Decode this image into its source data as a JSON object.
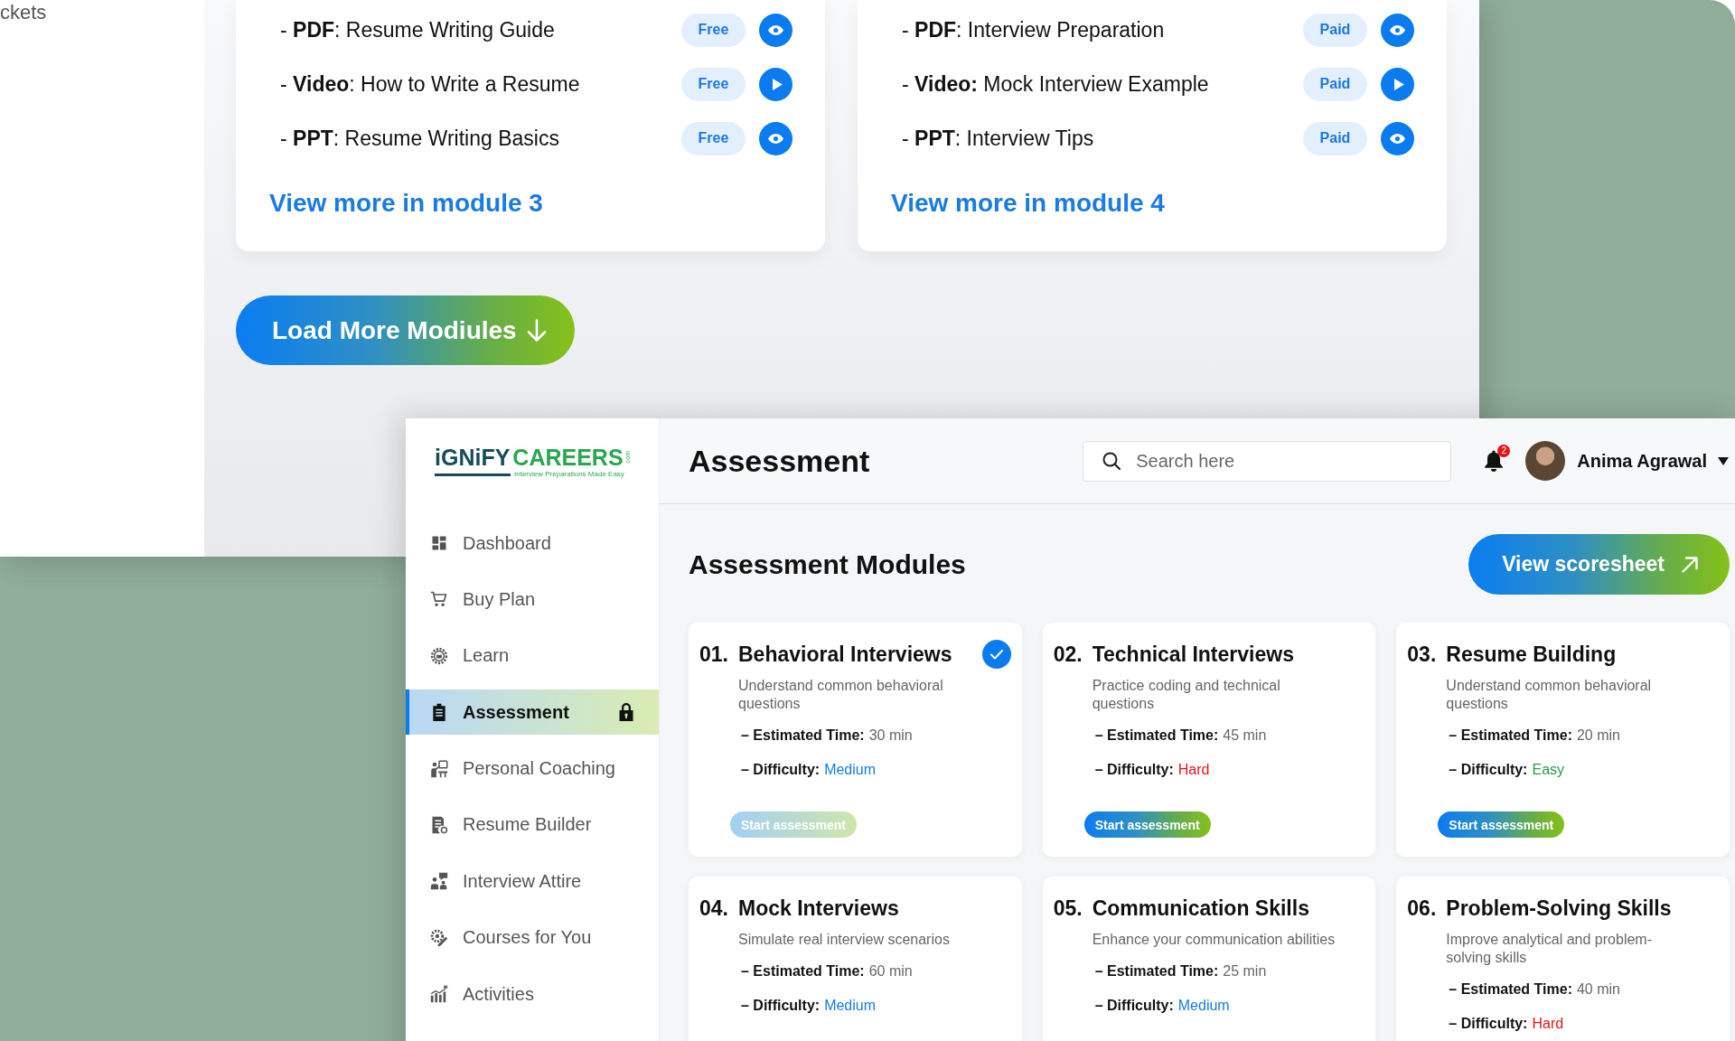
{
  "back_window": {
    "sidebar_fragment": "ckets",
    "resource_cards": [
      {
        "resources": [
          {
            "text": "- **PDF**: Resume Writing Guide",
            "access": "Free",
            "kind": "view"
          },
          {
            "text": "- **Video**: How to Write a Resume",
            "access": "Free",
            "kind": "play"
          },
          {
            "text": "- **PPT**: Resume Writing Basics",
            "access": "Free",
            "kind": "view"
          }
        ],
        "link": "View more in module 3"
      },
      {
        "resources": [
          {
            "text": "- **PDF**: Interview Preparation",
            "access": "Paid",
            "kind": "view"
          },
          {
            "text": "- **Video:** Mock Interview Example",
            "access": "Paid",
            "kind": "play"
          },
          {
            "text": "- **PPT**: Interview Tips",
            "access": "Paid",
            "kind": "view"
          }
        ],
        "link": "View more in module 4"
      }
    ],
    "load_more_button": "Load More Modiules"
  },
  "app": {
    "logo": {
      "brand": "iGNiFY",
      "brand_accent": "CAREERS",
      "domain": ".com",
      "tagline": "Interview Preparations Made Easy"
    },
    "sidebar": {
      "items": [
        {
          "label": "Dashboard",
          "selected": false,
          "locked": false
        },
        {
          "label": "Buy Plan",
          "selected": false,
          "locked": false
        },
        {
          "label": "Learn",
          "selected": false,
          "locked": false
        },
        {
          "label": "Assessment",
          "selected": true,
          "locked": true
        },
        {
          "label": "Personal Coaching",
          "selected": false,
          "locked": false
        },
        {
          "label": "Resume Builder",
          "selected": false,
          "locked": false
        },
        {
          "label": "Interview Attire",
          "selected": false,
          "locked": false
        },
        {
          "label": "Courses for You",
          "selected": false,
          "locked": false
        },
        {
          "label": "Activities",
          "selected": false,
          "locked": false
        }
      ]
    },
    "header": {
      "title": "Assessment",
      "search": {
        "placeholder": "Search here"
      },
      "notification_count": "2",
      "user": {
        "name": "Anima Agrawal"
      }
    },
    "section_title": "Assessment Modules",
    "scoresheet_button": "View scoresheet",
    "modules": [
      {
        "number": "01.",
        "title": "Behavioral Interviews",
        "description": "Understand common behavioral questions",
        "time_label": "– Estimated Time:",
        "time": "30 min",
        "difficulty_label": "– Difficulty:",
        "difficulty": {
          "value": "Medium",
          "color": "#1a7ae8"
        },
        "completed": true,
        "button": {
          "label": "Start assessment",
          "disabled": true
        }
      },
      {
        "number": "02.",
        "title": "Technical Interviews",
        "description": "Practice coding and technical questions",
        "time_label": "– Estimated Time:",
        "time": "45 min",
        "difficulty_label": "– Difficulty:",
        "difficulty": {
          "value": "Hard",
          "color": "#e3141b"
        },
        "completed": false,
        "button": {
          "label": "Start assessment",
          "disabled": false
        }
      },
      {
        "number": "03.",
        "title": "Resume Building",
        "description": "Understand common behavioral questions",
        "time_label": "– Estimated Time:",
        "time": "20 min",
        "difficulty_label": "– Difficulty:",
        "difficulty": {
          "value": "Easy",
          "color": "#2a9a4c"
        },
        "completed": false,
        "button": {
          "label": "Start assessment",
          "disabled": false
        }
      },
      {
        "number": "04.",
        "title": "Mock Interviews",
        "description": "Simulate real interview scenarios",
        "time_label": "– Estimated Time:",
        "time": "60 min",
        "difficulty_label": "– Difficulty:",
        "difficulty": {
          "value": "Medium",
          "color": "#1a7ae8"
        },
        "completed": false
      },
      {
        "number": "05.",
        "title": "Communication Skills",
        "description": "Enhance your communication abilities",
        "time_label": "– Estimated Time:",
        "time": "25 min",
        "difficulty_label": "– Difficulty:",
        "difficulty": {
          "value": "Medium",
          "color": "#1a7ae8"
        },
        "completed": false
      },
      {
        "number": "06.",
        "title": "Problem-Solving Skills",
        "description": "Improve analytical and problem-solving skills",
        "time_label": "– Estimated Time:",
        "time": "40 min",
        "difficulty_label": "– Difficulty:",
        "difficulty": {
          "value": "Hard",
          "color": "#e3141b"
        },
        "completed": false
      }
    ]
  }
}
